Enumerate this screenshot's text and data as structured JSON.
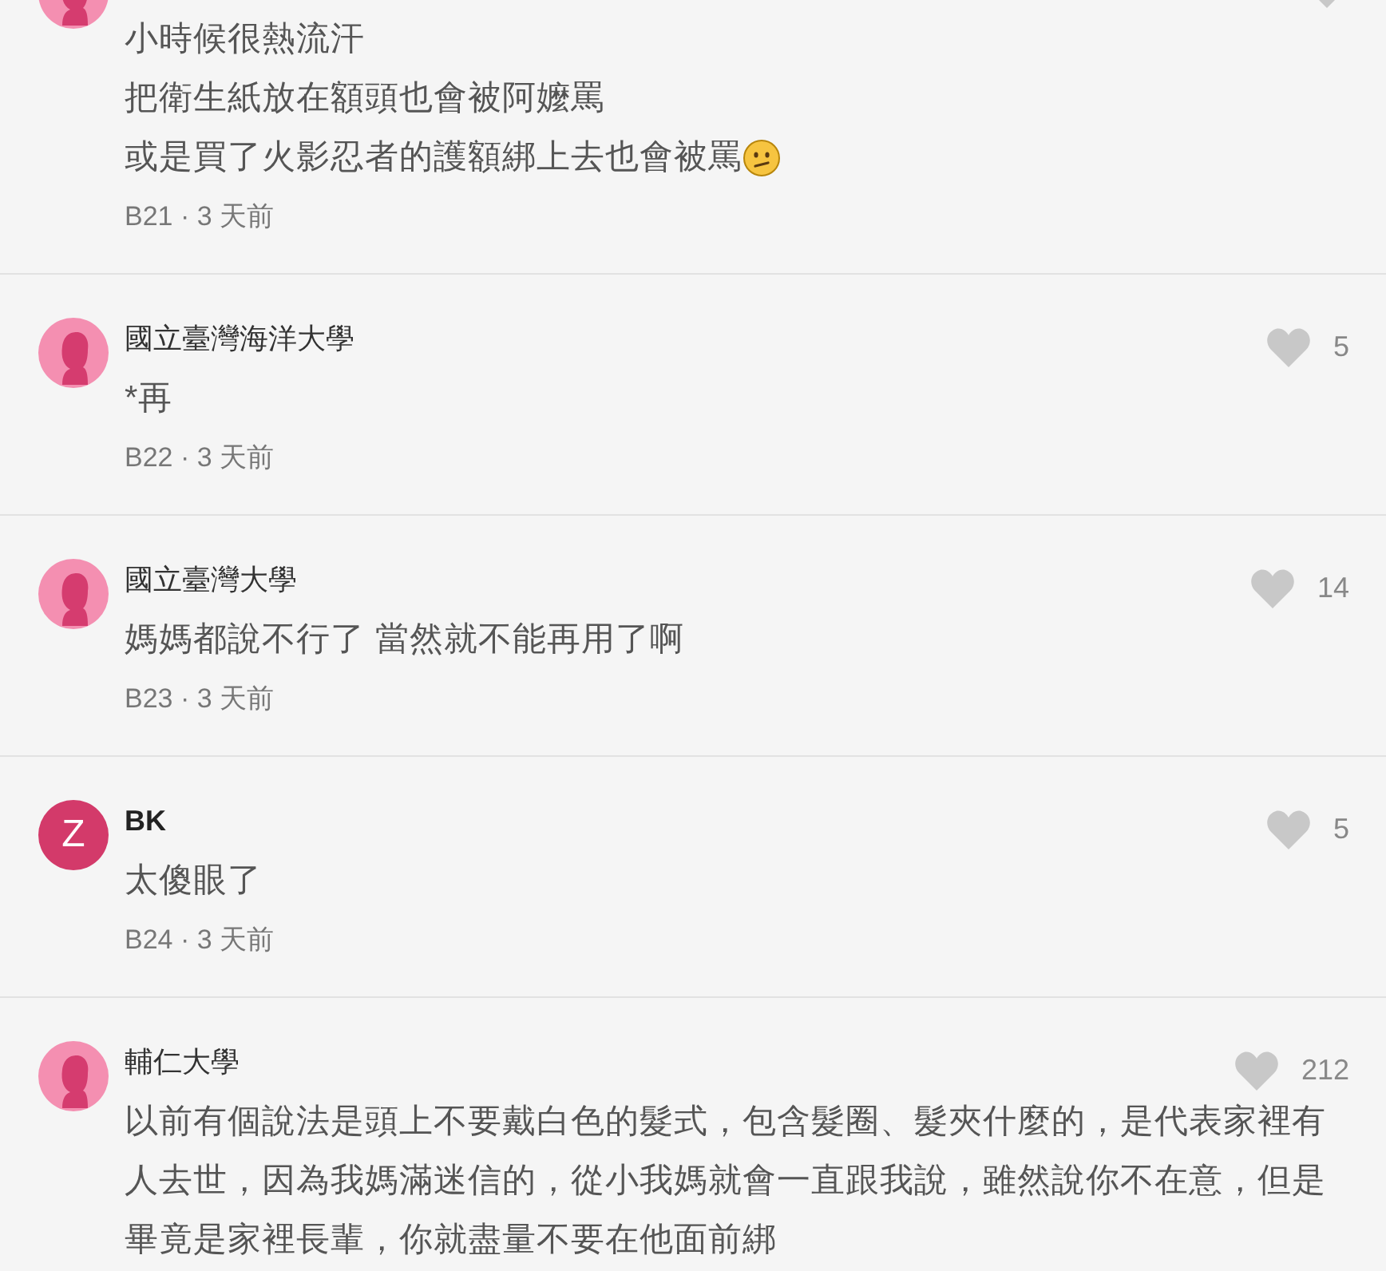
{
  "comments": [
    {
      "avatar": {
        "kind": "silhouette"
      },
      "lines": [
        "小時候很熱流汗",
        "把衛生紙放在額頭也會被阿嬤罵",
        "或是買了火影忍者的護額綁上去也會被罵"
      ],
      "kind": "with_emoji",
      "meta": "B21 · 3 天前"
    },
    {
      "avatar": {
        "kind": "silhouette"
      },
      "author": "國立臺灣海洋大學",
      "likes": "5",
      "lines": [
        "*再"
      ],
      "meta": "B22 · 3 天前"
    },
    {
      "avatar": {
        "kind": "silhouette"
      },
      "author": "國立臺灣大學",
      "likes": "14",
      "lines": [
        "媽媽都說不行了 當然就不能再用了啊"
      ],
      "meta": "B23 · 3 天前"
    },
    {
      "avatar": {
        "kind": "letter",
        "letter": "Z"
      },
      "author": "BK",
      "likes": "5",
      "lines": [
        "太傻眼了"
      ],
      "meta": "B24 · 3 天前"
    },
    {
      "avatar": {
        "kind": "silhouette"
      },
      "author": "輔仁大學",
      "likes": "212",
      "lines": [
        "以前有個說法是頭上不要戴白色的髮式，包含髮圈、髮夾什麼的，是代表家裡有人去世，因為我媽滿迷信的，從小我媽就會一直跟我說，雖然說你不在意，但是畢竟是家裡長輩，你就盡量不要在他面前綁"
      ]
    }
  ]
}
